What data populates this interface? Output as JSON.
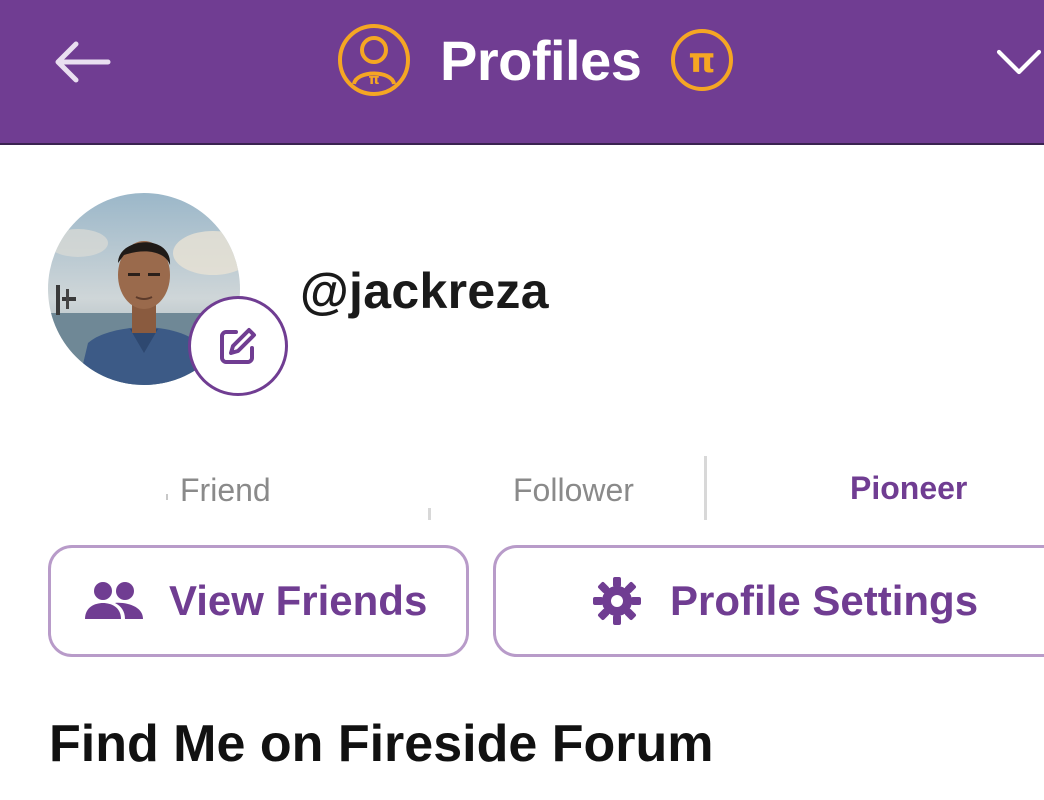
{
  "header": {
    "title": "Profiles",
    "back_icon": "arrow-left-icon",
    "profile_icon": "pi-profile-icon",
    "pi_coin_icon": "pi-coin-icon",
    "menu_icon": "chevron-down-icon",
    "bg_color": "#703d92",
    "accent_color": "#f5a623"
  },
  "profile": {
    "username": "@jackreza",
    "avatar": "profile-photo",
    "edit_icon": "edit-pencil-icon"
  },
  "stats": {
    "friend_label": "Friend",
    "follower_label": "Follower",
    "pioneer_label": "Pioneer"
  },
  "actions": {
    "view_friends_label": "View Friends",
    "view_friends_icon": "people-icon",
    "profile_settings_label": "Profile Settings",
    "profile_settings_icon": "gear-icon"
  },
  "section": {
    "title": "Find Me on Fireside Forum"
  }
}
